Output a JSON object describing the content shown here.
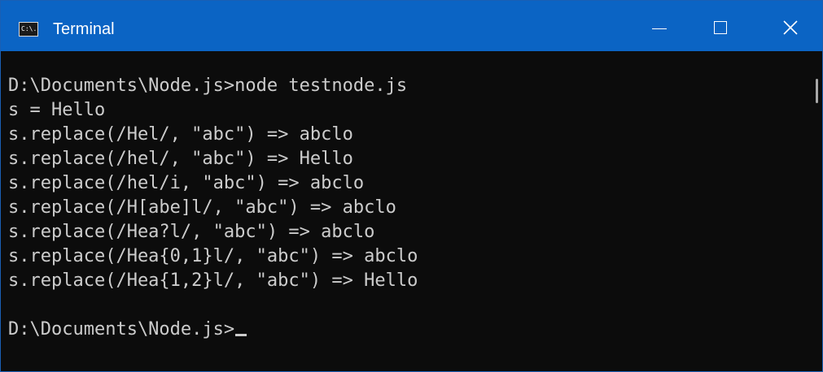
{
  "window": {
    "title": "Terminal",
    "icon_label": "C:\\."
  },
  "console": {
    "lines": [
      "D:\\Documents\\Node.js>node testnode.js",
      "s = Hello",
      "s.replace(/Hel/, \"abc\") => abclo",
      "s.replace(/hel/, \"abc\") => Hello",
      "s.replace(/hel/i, \"abc\") => abclo",
      "s.replace(/H[abe]l/, \"abc\") => abclo",
      "s.replace(/Hea?l/, \"abc\") => abclo",
      "s.replace(/Hea{0,1}l/, \"abc\") => abclo",
      "s.replace(/Hea{1,2}l/, \"abc\") => Hello",
      "",
      "D:\\Documents\\Node.js>"
    ]
  },
  "icons": {
    "app": "terminal-app-icon",
    "minimize": "minimize-icon",
    "maximize": "maximize-icon",
    "close": "close-icon"
  },
  "colors": {
    "titlebar": "#0b64c4",
    "background": "#0c0c0c",
    "text": "#cccccc"
  }
}
